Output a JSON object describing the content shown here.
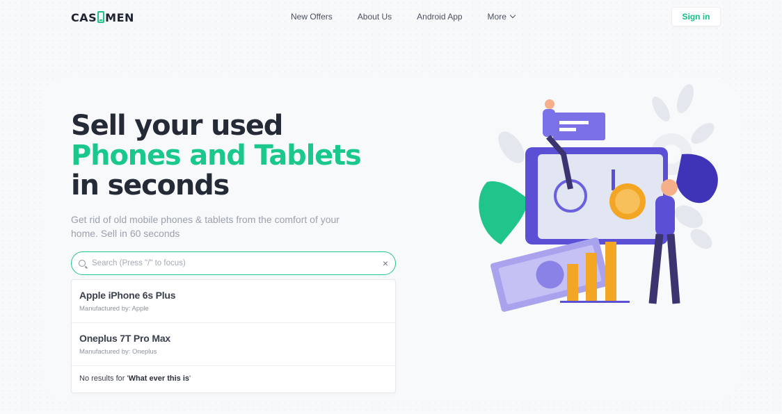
{
  "logo": {
    "left": "CAS",
    "right": "MEN"
  },
  "nav": {
    "items": [
      "New Offers",
      "About Us",
      "Android App"
    ],
    "more_label": "More"
  },
  "signin_label": "Sign in",
  "hero": {
    "line1": "Sell your used",
    "line2": "Phones and Tablets",
    "line3": "in seconds",
    "subtitle": "Get rid of old mobile phones & tablets from the comfort of your home. Sell in 60 seconds"
  },
  "search": {
    "placeholder": "Search (Press \"/\" to focus)",
    "value": ""
  },
  "results": [
    {
      "name": "Apple iPhone 6s Plus",
      "maker": "Manufactured by: Apple"
    },
    {
      "name": "Oneplus 7T Pro Max",
      "maker": "Manufactured by: Oneplus"
    }
  ],
  "no_results": {
    "prefix": "No results for '",
    "query": "What ever this is",
    "suffix": "'"
  },
  "colors": {
    "accent": "#19c88a",
    "dark": "#252a37",
    "purple": "#5b4fd6",
    "gold": "#f3a623"
  },
  "icons": [
    "search-icon",
    "clear-icon",
    "chevron-down-icon",
    "phone-logo-icon"
  ]
}
